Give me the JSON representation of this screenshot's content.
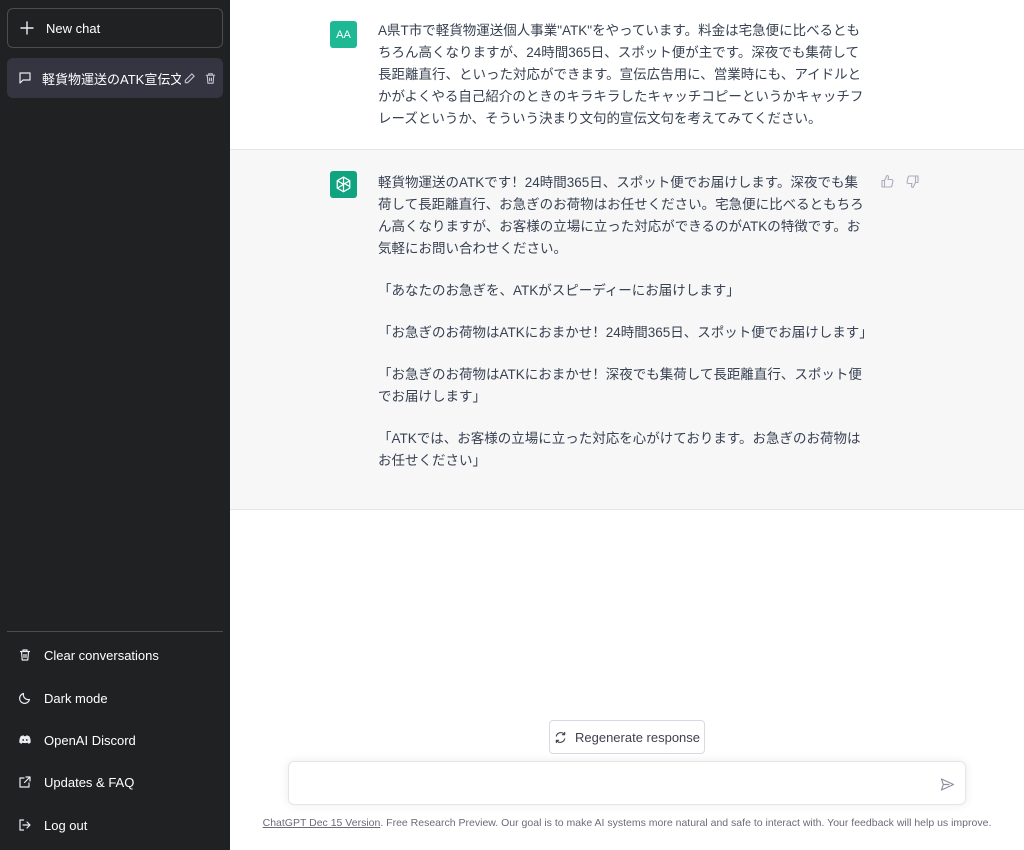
{
  "sidebar": {
    "new_chat_label": "New chat",
    "conversations": [
      {
        "title": "軽貨物運送のATK宣伝文"
      }
    ],
    "menu": {
      "clear": "Clear conversations",
      "dark_mode": "Dark mode",
      "discord": "OpenAI Discord",
      "updates": "Updates & FAQ",
      "logout": "Log out"
    }
  },
  "chat": {
    "user_avatar_initials": "AA",
    "user_message": "A県T市で軽貨物運送個人事業\"ATK\"をやっています。料金は宅急便に比べるともちろん高くなりますが、24時間365日、スポット便が主です。深夜でも集荷して長距離直行、といった対応ができます。宣伝広告用に、営業時にも、アイドルとかがよくやる自己紹介のときのキラキラしたキャッチコピーというかキャッチフレーズというか、そういう決まり文句的宣伝文句を考えてみてください。",
    "assistant_paragraphs": [
      "軽貨物運送のATKです！24時間365日、スポット便でお届けします。深夜でも集荷して長距離直行、お急ぎのお荷物はお任せください。宅急便に比べるともちろん高くなりますが、お客様の立場に立った対応ができるのがATKの特徴です。お気軽にお問い合わせください。",
      "「あなたのお急ぎを、ATKがスピーディーにお届けします」",
      "「お急ぎのお荷物はATKにおまかせ！24時間365日、スポット便でお届けします」",
      "「お急ぎのお荷物はATKにおまかせ！深夜でも集荷して長距離直行、スポット便でお届けします」",
      "「ATKでは、お客様の立場に立った対応を心がけております。お急ぎのお荷物はお任せください」"
    ]
  },
  "composer": {
    "regenerate_label": "Regenerate response",
    "input_value": "",
    "input_placeholder": ""
  },
  "footer": {
    "version_link": "ChatGPT Dec 15 Version",
    "text": ". Free Research Preview. Our goal is to make AI systems more natural and safe to interact with. Your feedback will help us improve."
  },
  "colors": {
    "sidebar_bg": "#202123",
    "accent": "#10a37f",
    "user_avatar": "#1fb894"
  },
  "icons": [
    "plus-icon",
    "chat-bubble-icon",
    "edit-icon",
    "trash-icon",
    "moon-icon",
    "discord-icon",
    "external-link-icon",
    "logout-icon",
    "openai-logo-icon",
    "thumbs-up-icon",
    "thumbs-down-icon",
    "refresh-icon",
    "send-icon"
  ]
}
